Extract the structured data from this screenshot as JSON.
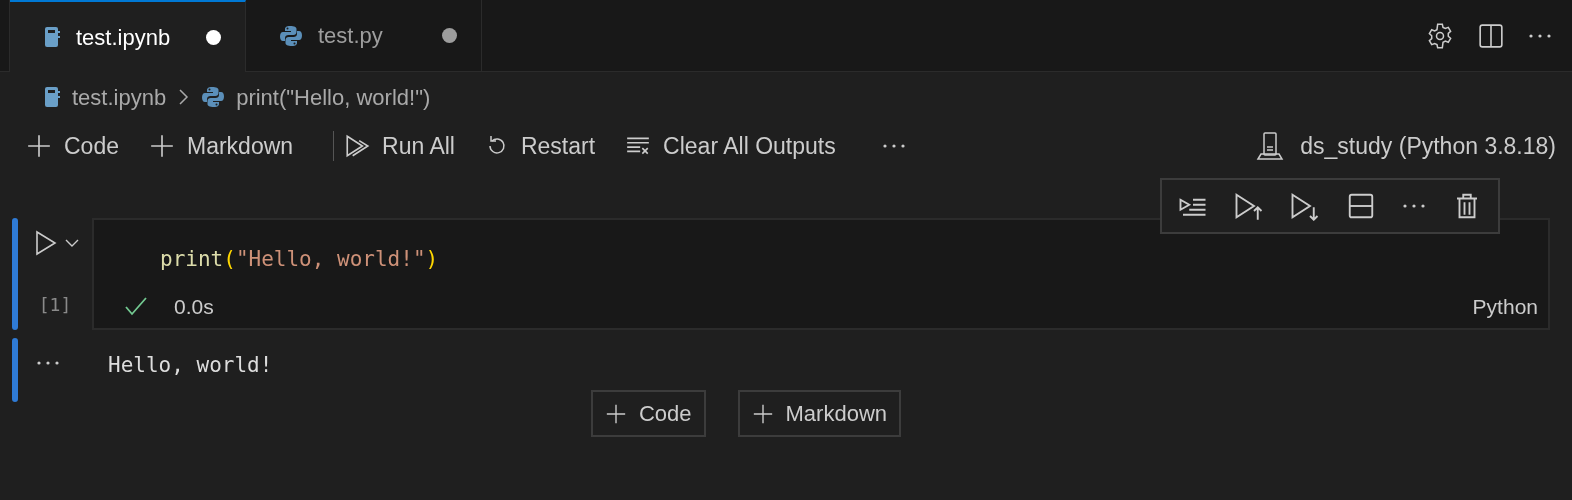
{
  "tabs": [
    {
      "label": "test.ipynb",
      "kind": "notebook",
      "selected": true,
      "modified": true
    },
    {
      "label": "test.py",
      "kind": "python",
      "selected": false,
      "modified": true
    }
  ],
  "breadcrumbs": [
    {
      "label": "test.ipynb",
      "kind": "notebook"
    },
    {
      "label": "print(\"Hello, world!\")",
      "kind": "python"
    }
  ],
  "toolbar": [
    {
      "label": "Code",
      "kind": "add"
    },
    {
      "label": "Markdown",
      "kind": "add"
    },
    {
      "kind": "separator"
    },
    {
      "label": "Run All",
      "kind": "run-all"
    },
    {
      "label": "Restart",
      "kind": "restart"
    },
    {
      "label": "Clear All Outputs",
      "kind": "clear"
    },
    {
      "kind": "more"
    }
  ],
  "kernel": "ds_study (Python 3.8.18)",
  "cell": {
    "execution_count": "[1]",
    "code": [
      {
        "text": "print",
        "kind": "function"
      },
      {
        "text": "(",
        "kind": "bracket"
      },
      {
        "text": "\"Hello, world!\"",
        "kind": "string"
      },
      {
        "text": ")",
        "kind": "bracket"
      }
    ],
    "succeeded": true,
    "duration": "0.0s",
    "language": "Python",
    "output": "Hello, world!"
  },
  "add_cell_buttons": [
    "Code",
    "Markdown"
  ]
}
